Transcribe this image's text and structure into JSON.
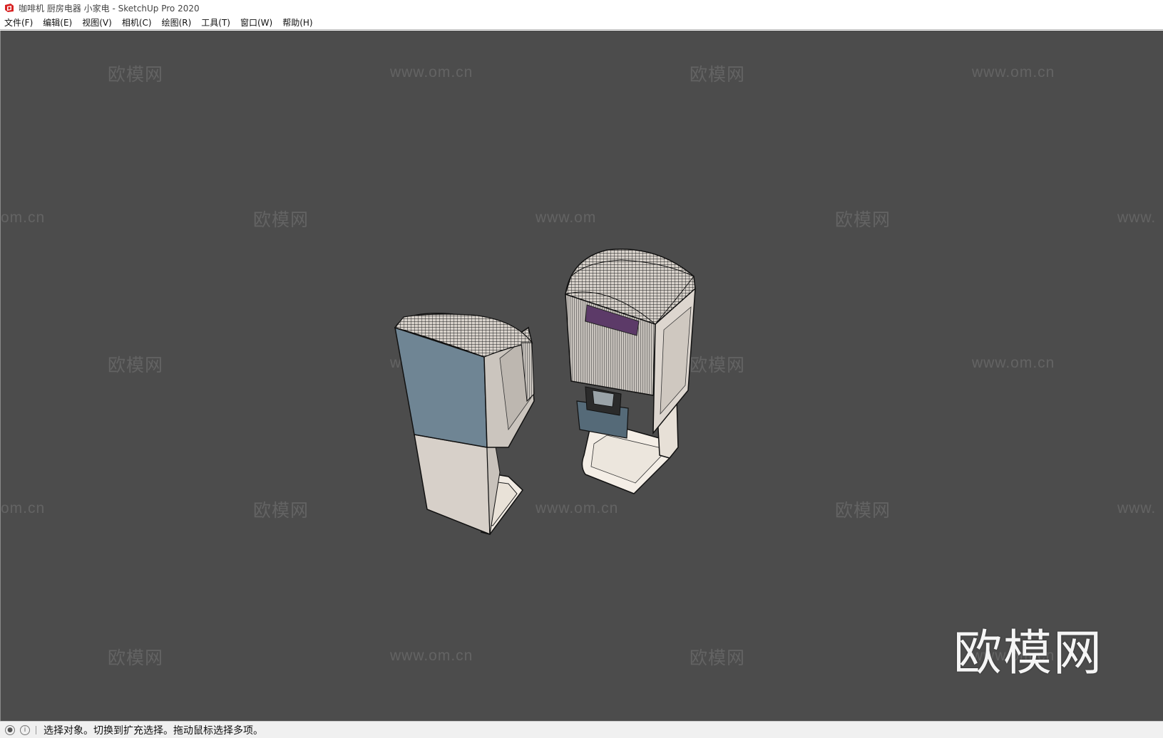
{
  "window": {
    "title": "咖啡机 厨房电器 小家电 - SketchUp Pro 2020",
    "app_icon": "sketchup-logo-icon",
    "accent": "#d82222"
  },
  "menubar": {
    "items": [
      {
        "label": "文件(F)"
      },
      {
        "label": "编辑(E)"
      },
      {
        "label": "视图(V)"
      },
      {
        "label": "相机(C)"
      },
      {
        "label": "绘图(R)"
      },
      {
        "label": "工具(T)"
      },
      {
        "label": "窗口(W)"
      },
      {
        "label": "帮助(H)"
      }
    ]
  },
  "viewport": {
    "background": "#4c4c4c",
    "watermark_brand": "欧模网",
    "watermark_url": "www.om.cn",
    "watermark_url_partial_left": "om.cn",
    "watermark_url_partial_right": "www.",
    "watermark_url_partial_center": "www.om",
    "watermark_url_partial_center2": "www.om.c",
    "big_watermark": "欧模网"
  },
  "statusbar": {
    "icon_left": "geo-location-icon",
    "icon_info": "info-icon",
    "message": "选择对象。切换到扩充选择。拖动鼠标选择多项。"
  }
}
